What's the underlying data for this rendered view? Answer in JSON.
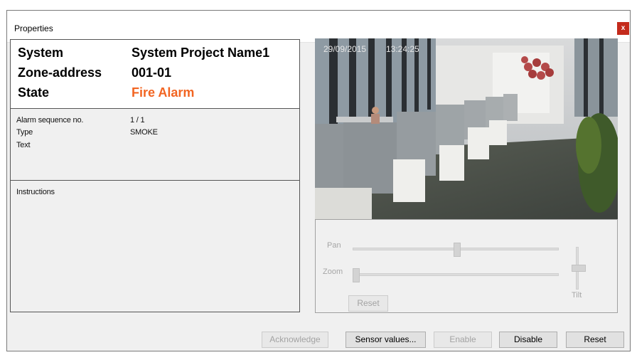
{
  "window": {
    "title": "Properties",
    "close_label": "x"
  },
  "header": {
    "system_label": "System",
    "system_value": "System Project Name1",
    "zone_label": "Zone-address",
    "zone_value": "001-01",
    "state_label": "State",
    "state_value": "Fire Alarm",
    "state_color": "#f26522"
  },
  "details": {
    "seq_label": "Alarm sequence no.",
    "seq_value": "1 / 1",
    "type_label": "Type",
    "type_value": "SMOKE",
    "text_label": "Text"
  },
  "instructions": {
    "label": "Instructions"
  },
  "camera": {
    "date": "29/09/2015",
    "time": "13:24:25"
  },
  "ptz": {
    "pan_label": "Pan",
    "zoom_label": "Zoom",
    "tilt_label": "Tilt",
    "reset_label": "Reset",
    "pan_level": 0.5,
    "zoom_level": 0.0,
    "tilt_level": 0.5
  },
  "buttons": {
    "acknowledge": "Acknowledge",
    "sensor_values": "Sensor values...",
    "enable": "Enable",
    "disable": "Disable",
    "reset": "Reset"
  }
}
